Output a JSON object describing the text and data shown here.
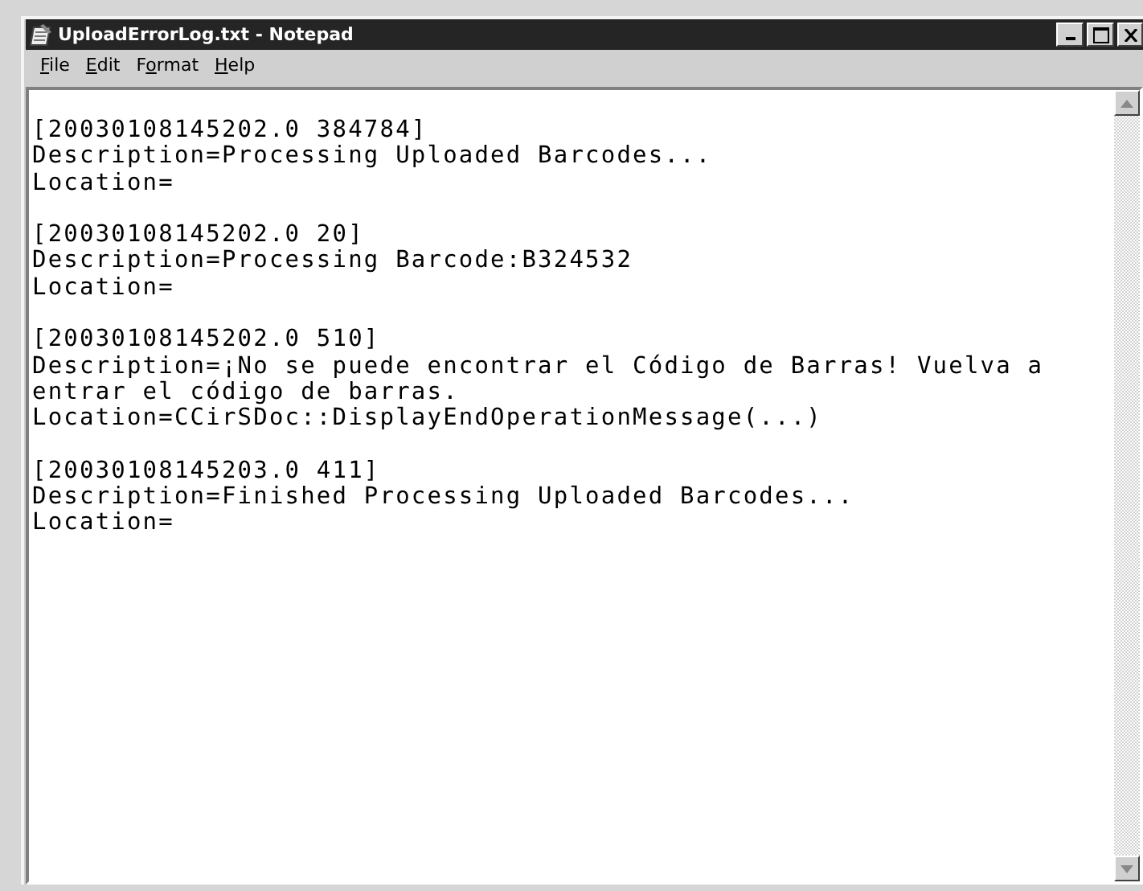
{
  "window": {
    "title": "UploadErrorLog.txt - Notepad"
  },
  "menu": [
    {
      "parts": [
        {
          "text": "F",
          "underlined": true
        },
        {
          "text": "ile",
          "underlined": false
        }
      ]
    },
    {
      "parts": [
        {
          "text": "E",
          "underlined": true
        },
        {
          "text": "dit",
          "underlined": false
        }
      ]
    },
    {
      "parts": [
        {
          "text": "F",
          "underlined": false
        },
        {
          "text": "o",
          "underlined": true
        },
        {
          "text": "rmat",
          "underlined": false
        }
      ]
    },
    {
      "parts": [
        {
          "text": "H",
          "underlined": true
        },
        {
          "text": "elp",
          "underlined": false
        }
      ]
    }
  ],
  "document": {
    "entries": [
      {
        "lines": [
          "[20030108145202.0 384784]",
          "Description=Processing Uploaded Barcodes...",
          "Location="
        ]
      },
      {
        "lines": [
          "[20030108145202.0 20]",
          "Description=Processing Barcode:B324532",
          "Location="
        ]
      },
      {
        "lines": [
          "[20030108145202.0 510]",
          "Description=¡No se puede encontrar el Código de Barras! Vuelva a",
          "entrar el código de barras.",
          "Location=CCirSDoc::DisplayEndOperationMessage(...)"
        ]
      },
      {
        "lines": [
          "[20030108145203.0 411]",
          "Description=Finished Processing Uploaded Barcodes...",
          "Location="
        ]
      }
    ]
  }
}
